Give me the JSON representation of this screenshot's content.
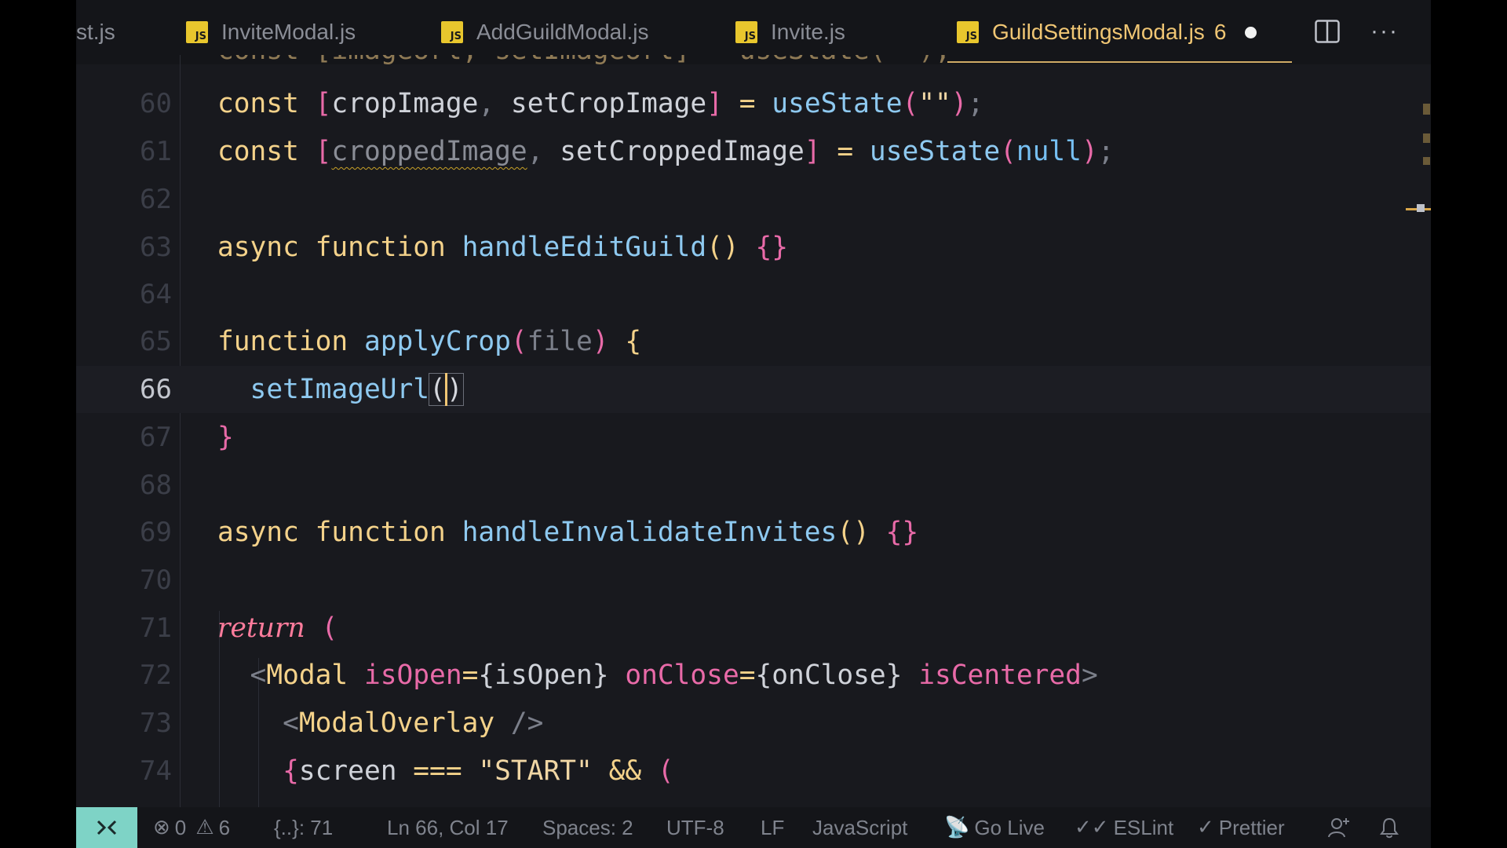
{
  "tabs": [
    {
      "label": "st.js",
      "icon": "none"
    },
    {
      "label": "InviteModal.js",
      "icon": "js-file-icon"
    },
    {
      "label": "AddGuildModal.js",
      "icon": "js-file-icon"
    },
    {
      "label": "Invite.js",
      "icon": "js-file-icon"
    },
    {
      "label": "GuildSettingsModal.js",
      "icon": "js-file-icon",
      "problems": "6",
      "active": true,
      "modified": true
    }
  ],
  "file_icon_text": "JS",
  "editor": {
    "top_partial_line": "const [imageUrl, setImageUrl] = useState(\"\");",
    "line_numbers": [
      "60",
      "61",
      "62",
      "63",
      "64",
      "65",
      "66",
      "67",
      "68",
      "69",
      "70",
      "71",
      "72",
      "73",
      "74"
    ],
    "current_line": "66"
  },
  "status": {
    "errors": "0",
    "warnings": "6",
    "breadcrumb": "{..}: 71",
    "position": "Ln 66, Col 17",
    "spaces": "Spaces: 2",
    "encoding": "UTF-8",
    "eol": "LF",
    "language": "JavaScript",
    "go_live": "Go Live",
    "eslint": "ESLint",
    "prettier": "Prettier"
  },
  "colors": {
    "accent": "#f0c674",
    "remote": "#7ed3c6",
    "background": "#18191e"
  }
}
